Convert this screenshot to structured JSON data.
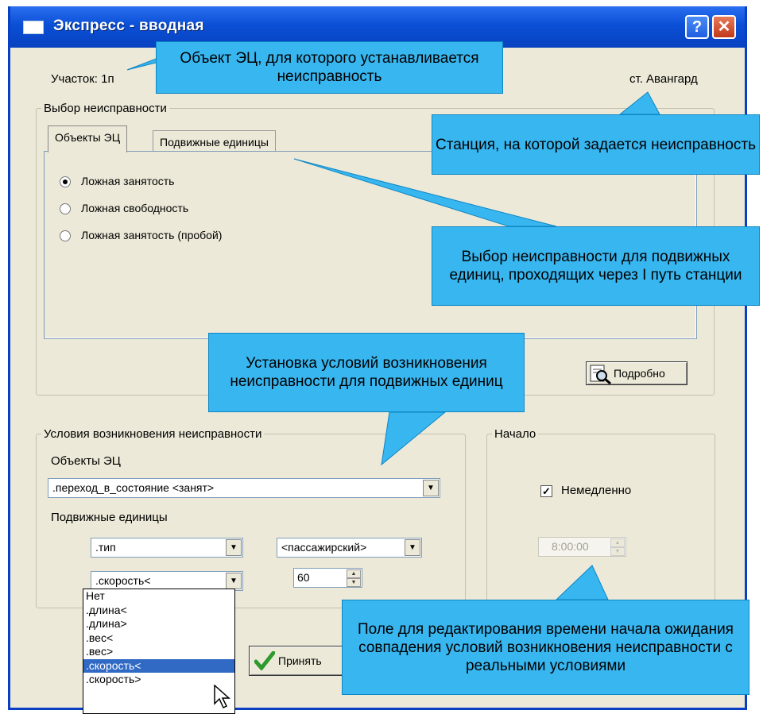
{
  "window": {
    "title": "Экспресс - вводная",
    "help_label": "?",
    "close_label": "✕"
  },
  "header": {
    "section_label": "Участок: 1п",
    "station_label": "ст. Авангард"
  },
  "fault_selection": {
    "legend": "Выбор неисправности",
    "tabs": [
      {
        "label": "Объекты ЭЦ",
        "active": true
      },
      {
        "label": "Подвижные единицы",
        "active": false
      }
    ],
    "options": [
      {
        "label": "Ложная занятость",
        "checked": true
      },
      {
        "label": "Ложная свободность",
        "checked": false
      },
      {
        "label": "Ложная занятость (пробой)",
        "checked": false
      }
    ],
    "details_button": "Подробно"
  },
  "conditions": {
    "legend": "Условия возникновения неисправности",
    "objects_label": "Объекты ЭЦ",
    "objects_value": ".переход_в_состояние <занят>",
    "units_label": "Подвижные единицы",
    "type_param": ".тип",
    "type_value": "<пассажирский>",
    "speed_param": ".скорость<",
    "speed_value": "60",
    "param_options": [
      ".тип",
      "Нет",
      ".длина<",
      ".длина>",
      ".вес<",
      ".вес>",
      ".скорость<",
      ".скорость>"
    ],
    "param_options_visible": [
      "Нет",
      ".длина<",
      ".длина>",
      ".вес<",
      ".вес>",
      ".скорость<",
      ".скорость>"
    ],
    "selected_option": ".скорость<"
  },
  "start": {
    "legend": "Начало",
    "immediately_label": "Немедленно",
    "immediately_checked": true,
    "time_value": "8:00:00"
  },
  "footer": {
    "accept_button": "Принять"
  },
  "callouts": {
    "object": "Объект ЭЦ, для которого устанавливается неисправность",
    "station": "Станция, на которой задается неисправность",
    "units_fault": "Выбор неисправности для подвижных единиц, проходящих через I путь станции",
    "conditions": "Установка условий возникновения неисправности для подвижных единиц",
    "time_field": "Поле для редактирования времени начала ожидания совпадения условий возникновения неисправности с реальными условиями"
  },
  "colors": {
    "titlebar": "#0a4fd6",
    "window_bg": "#ece9d8",
    "callout_bg": "#38b6f0",
    "selection": "#316ac5",
    "check_green": "#2e9a2e"
  },
  "icons": {
    "window": "window-icon",
    "details": "magnifier-icon",
    "accept": "checkmark-icon",
    "cursor": "mouse-pointer-icon"
  }
}
